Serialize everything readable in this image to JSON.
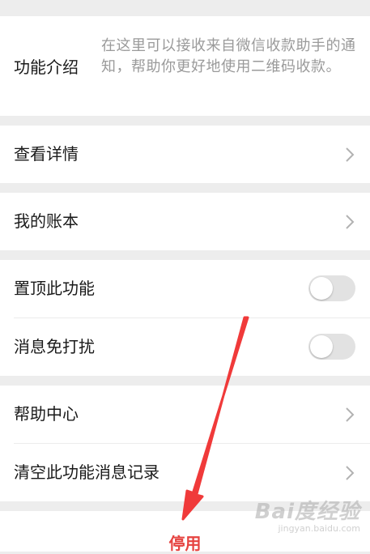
{
  "intro": {
    "label": "功能介绍",
    "description": "在这里可以接收来自微信收款助手的通知，帮助你更好地使用二维码收款。"
  },
  "rows": {
    "view_details": "查看详情",
    "my_ledger": "我的账本",
    "pin_feature": "置顶此功能",
    "do_not_disturb": "消息免打扰",
    "help_center": "帮助中心",
    "clear_messages": "清空此功能消息记录"
  },
  "toggles": {
    "pin_feature_on": false,
    "do_not_disturb_on": false
  },
  "footer": {
    "disable_label": "停用"
  },
  "watermark": {
    "logo_text": "Bai度经验",
    "url": "jingyan.baidu.com"
  },
  "colors": {
    "background": "#ededed",
    "card": "#ffffff",
    "disable_text": "#e64340",
    "annotation_arrow": "#f03a3a",
    "secondary_text": "#9a9a9a"
  },
  "icons": {
    "row_chevron": "chevron-right-icon",
    "annotation": "red-arrow-annotation"
  }
}
